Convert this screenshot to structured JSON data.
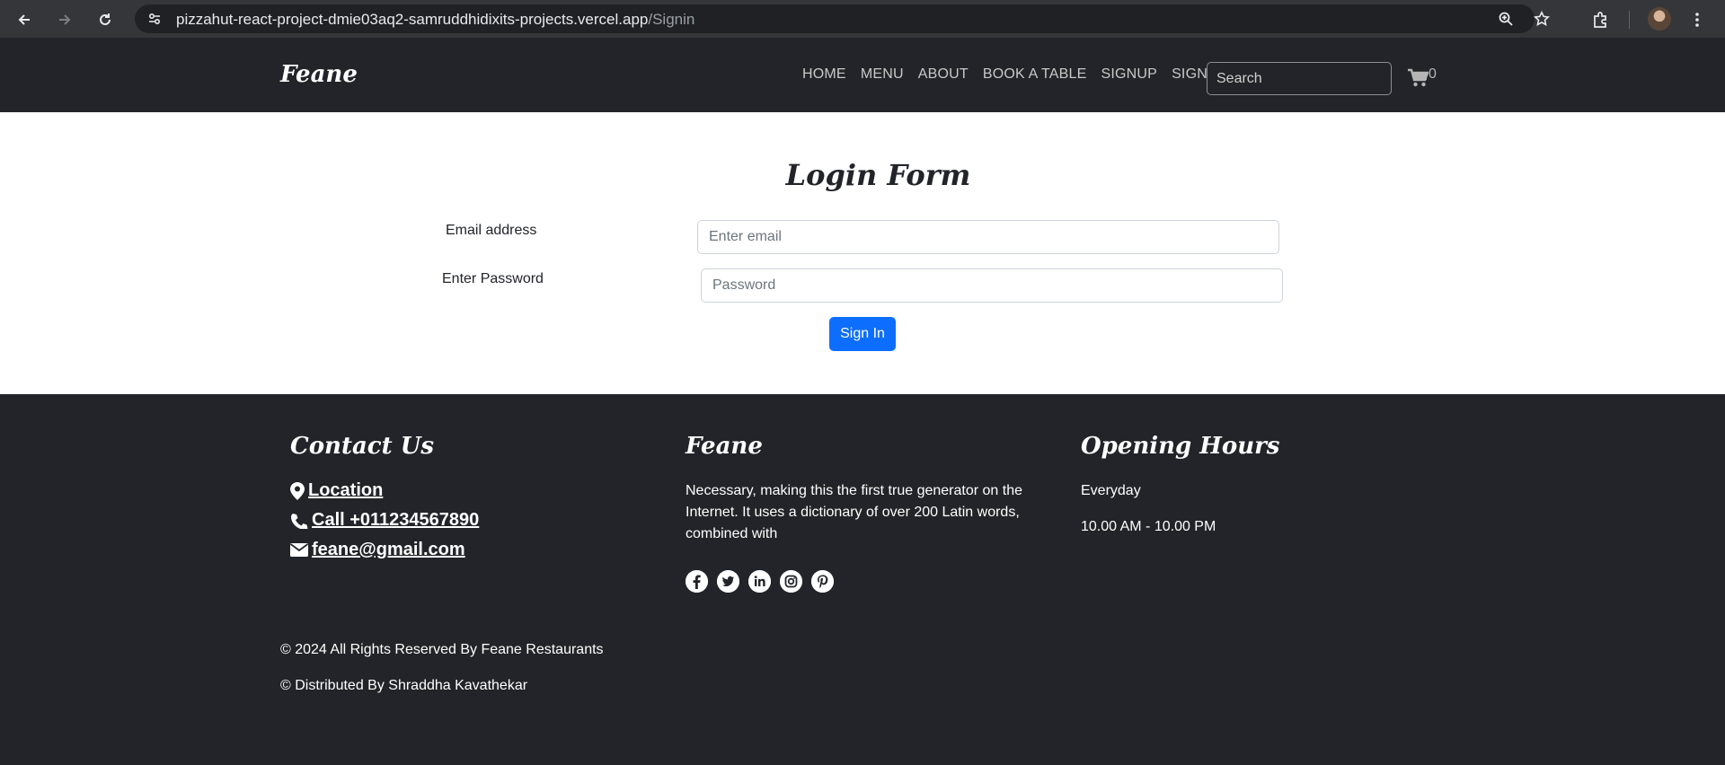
{
  "browser": {
    "url_host": "pizzahut-react-project-dmie03aq2-samruddhidixits-projects.vercel.app",
    "url_path": "/Signin"
  },
  "nav": {
    "brand": "Feane",
    "links": [
      "HOME",
      "MENU",
      "ABOUT",
      "BOOK A TABLE",
      "SIGNUP",
      "SIGNIN"
    ],
    "search_placeholder": "Search",
    "cart_count": "0"
  },
  "form": {
    "title": "Login Form",
    "email_label": "Email address",
    "email_placeholder": "Enter email",
    "password_label": "Enter Password",
    "password_placeholder": "Password",
    "submit_label": "Sign In"
  },
  "footer": {
    "contact_heading": "Contact Us",
    "location": " Location",
    "phone": " Call +011234567890",
    "email": " feane@gmail.com",
    "about_heading": "Feane",
    "about_text": "Necessary, making this the first true generator on the Internet. It uses a dictionary of over 200 Latin words, combined with",
    "social_icons": [
      "facebook-icon",
      "twitter-icon",
      "linkedin-icon",
      "instagram-icon",
      "pinterest-icon"
    ],
    "hours_heading": "Opening Hours",
    "hours_days": "Everyday",
    "hours_time": "10.00 AM - 10.00 PM",
    "copyright": "© 2024 All Rights Reserved By Feane Restaurants",
    "distributed": "© Distributed By Shraddha Kavathekar"
  },
  "colors": {
    "nav_bg": "#222429",
    "primary_button": "#0d6efd",
    "browser_bar": "#35363a"
  }
}
